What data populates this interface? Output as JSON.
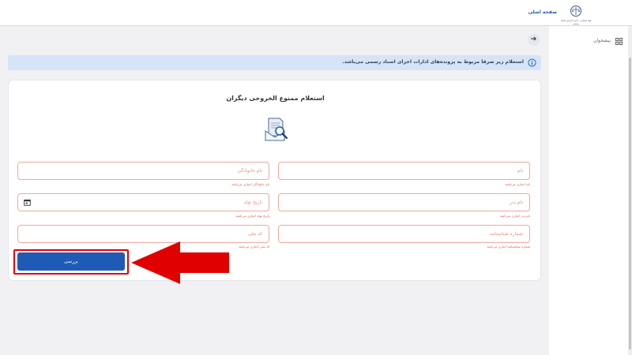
{
  "header": {
    "home_link": "صفحه اصلی",
    "logo_caption": "قوه قضاییه · اداره اجرای اسناد رسمی"
  },
  "sidebar": {
    "items": [
      {
        "label": "پیشخوان",
        "icon": "dashboard-grid-icon"
      }
    ]
  },
  "navigation": {
    "back_icon": "arrow-right-icon"
  },
  "banner": {
    "text": "استعلام زیر صرفا مربوط به پرونده‌های ادارات اجرای اسناد رسمی می‌باشد.",
    "icon": "info-icon",
    "background": "#d6e4f8"
  },
  "form": {
    "title": "استعلام ممنوع الخروجی دیگران",
    "hero_icon": "document-search-icon",
    "fields": {
      "first_name": {
        "placeholder": "نام",
        "hint": "نام اجباری می‌باشد"
      },
      "last_name": {
        "placeholder": "نام خانوادگی",
        "hint": "نام خانوادگی اجباری می‌باشد"
      },
      "father_name": {
        "placeholder": "نام پدر",
        "hint": "نام پدر اجباری می‌باشد"
      },
      "birth_date": {
        "placeholder": "تاریخ تولد",
        "hint": "تاریخ تولد اجباری می‌باشد",
        "icon": "calendar-icon"
      },
      "id_number": {
        "placeholder": "شماره شناسنامه",
        "hint": "شماره شناسنامه اجباری می‌باشد"
      },
      "national_code": {
        "placeholder": "کد ملی",
        "hint": "کد ملی اجباری می‌باشد"
      }
    },
    "submit_label": "بررسی"
  },
  "colors": {
    "primary": "#1f5bb5",
    "error": "#e0533f",
    "annotation": "#e00000"
  }
}
